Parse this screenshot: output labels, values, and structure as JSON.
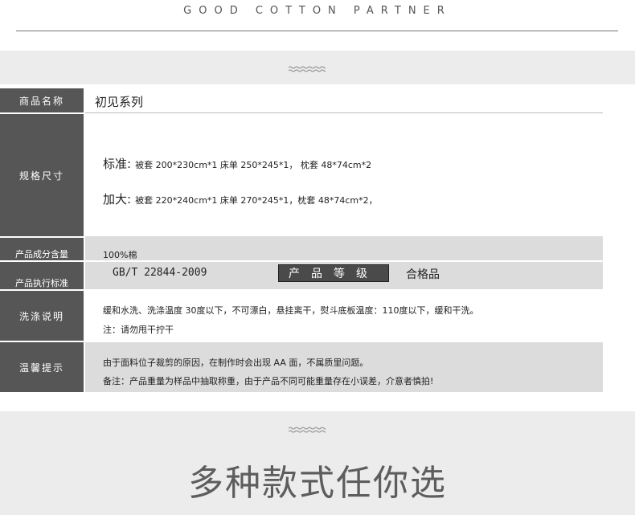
{
  "brand": "GOOD COTTON PARTNER",
  "rows": {
    "name": {
      "label": "商品名称",
      "value": "初见系列"
    },
    "size": {
      "label": "规格尺寸",
      "standard_prefix": "标准:",
      "standard_text": "被套 200*230cm*1 床单 250*245*1，  枕套 48*74cm*2",
      "large_prefix": "加大:",
      "large_text": "被套 220*240cm*1  床单 270*245*1，枕套 48*74cm*2，"
    },
    "material": {
      "label": "产品成分含量",
      "value": "100%棉"
    },
    "standard": {
      "label": "产品执行标准",
      "value": "GB/T 22844-2009",
      "grade_label": "产品等级",
      "grade_value": "合格品"
    },
    "wash": {
      "label": "洗涤说明",
      "line1": "缓和水洗、洗涤温度 30度以下，不可漂白，悬挂离干，熨斗底板温度：110度以下，缓和干洗。",
      "line2": "注：请勿甩干拧干"
    },
    "tips": {
      "label": "温馨提示",
      "line1": "由于面料位子裁剪的原因，在制作时会出现 AA 面，不属质里问题。",
      "line2": "备注：产品重量为样品中抽取称重，由于产品不同可能重量存在小误差，介意者慎拍!"
    }
  },
  "slogan": "多种款式任你选"
}
